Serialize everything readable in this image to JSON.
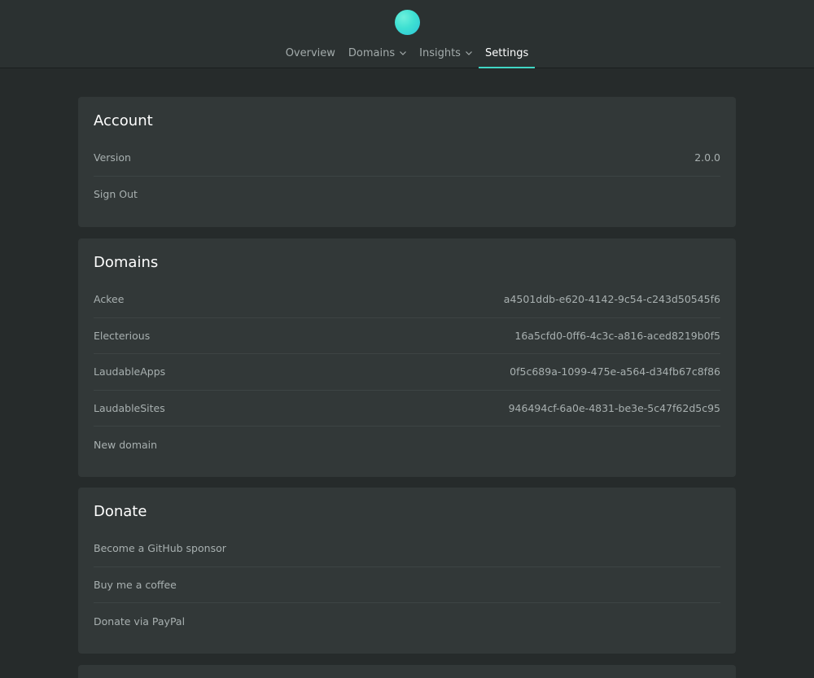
{
  "nav": {
    "items": [
      {
        "label": "Overview",
        "dropdown": false,
        "active": false
      },
      {
        "label": "Domains",
        "dropdown": true,
        "active": false
      },
      {
        "label": "Insights",
        "dropdown": true,
        "active": false
      },
      {
        "label": "Settings",
        "dropdown": false,
        "active": true
      }
    ]
  },
  "account": {
    "title": "Account",
    "version_label": "Version",
    "version_value": "2.0.0",
    "sign_out": "Sign Out"
  },
  "domains": {
    "title": "Domains",
    "items": [
      {
        "name": "Ackee",
        "id": "a4501ddb-e620-4142-9c54-c243d50545f6"
      },
      {
        "name": "Electerious",
        "id": "16a5cfd0-0ff6-4c3c-a816-aced8219b0f5"
      },
      {
        "name": "LaudableApps",
        "id": "0f5c689a-1099-475e-a564-d34fb67c8f86"
      },
      {
        "name": "LaudableSites",
        "id": "946494cf-6a0e-4831-be3e-5c47f62d5c95"
      }
    ],
    "new_domain": "New domain"
  },
  "donate": {
    "title": "Donate",
    "items": [
      "Become a GitHub sponsor",
      "Buy me a coffee",
      "Donate via PayPal"
    ]
  },
  "colors": {
    "accent": "#40d6c4",
    "background": "#262b2b",
    "card": "#323838"
  },
  "icons": {
    "logo": "ackee-logo-icon",
    "dropdown": "chevron-down-icon"
  }
}
